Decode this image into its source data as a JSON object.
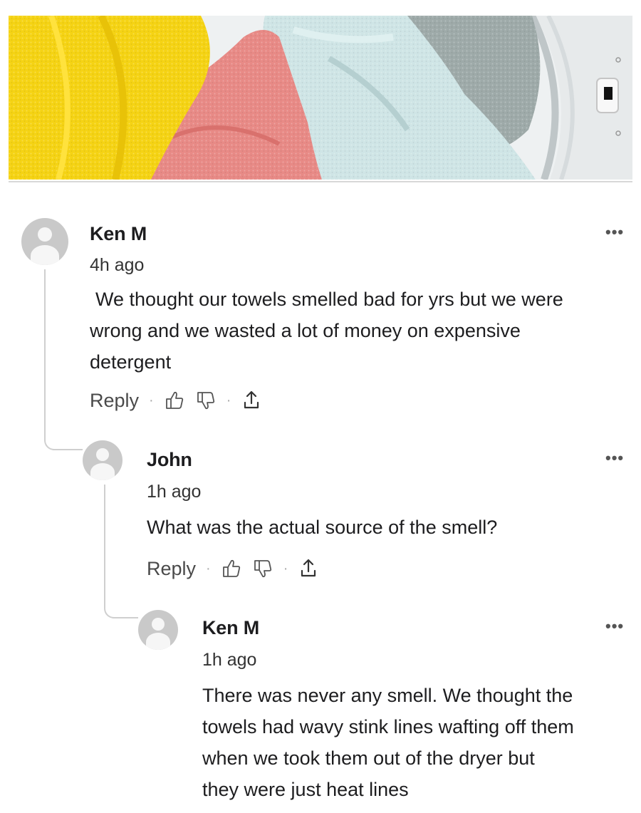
{
  "comments": [
    {
      "author": "Ken M",
      "time": "4h ago",
      "lines": [
        "We thought our towels smelled bad for yrs but we were",
        "wrong and we wasted a lot of money on expensive",
        "detergent"
      ],
      "reply_label": "Reply"
    },
    {
      "author": "John",
      "time": "1h ago",
      "lines": [
        "What was the actual source of the smell?"
      ],
      "reply_label": "Reply"
    },
    {
      "author": "Ken M",
      "time": "1h ago",
      "lines": [
        "There was never any smell. We thought the",
        "towels had wavy stink lines wafting off them",
        "when we took them out of the dryer but",
        "they were just heat lines"
      ]
    }
  ],
  "icons": {
    "avatar": "user-avatar-icon",
    "like": "thumbs-up-icon",
    "dislike": "thumbs-down-icon",
    "share": "share-icon",
    "more": "more-options-icon"
  },
  "more_glyph": "•••",
  "separator_glyph": "·",
  "colors": {
    "towel_yellow": "#f5d314",
    "towel_pink": "#e88a86",
    "towel_light_blue": "#cfe5e6",
    "towel_grey": "#9eaaa9",
    "avatar_grey": "#c9c9c9"
  }
}
